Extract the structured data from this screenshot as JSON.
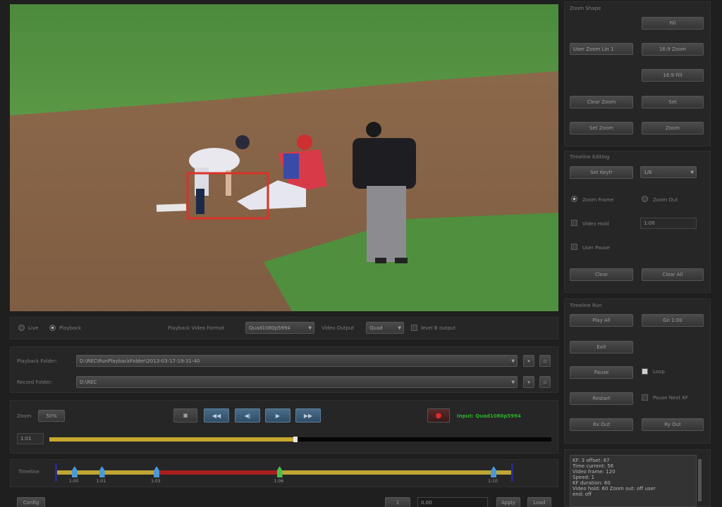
{
  "video": {
    "colors": {
      "grass": "#4f8a3e",
      "dirt": "#8a6a4a",
      "zoom_box": "#d8332a"
    }
  },
  "source": {
    "live_label": "Live",
    "playback_label": "Playback",
    "selected": "playback",
    "format_label": "Playback Video Format",
    "format_value": "Quad1080p5994",
    "output_label": "Video Output",
    "output_value": "Quad",
    "level_b_label": "level B output"
  },
  "folders": {
    "playback_label": "Playback Folder:",
    "playback_path": "D:\\REC\\RunPlaybackFolder\\2013-03-17-19-31-40",
    "record_label": "Record Folder:",
    "record_path": "D:\\REC"
  },
  "transport": {
    "zoom_label": "Zoom",
    "zoom_value": "50%",
    "input_status": "Input: Quad1080p5994",
    "timecode": "1:01",
    "progress": 0.49
  },
  "timeline": {
    "label": "Timeline",
    "keyframes": [
      {
        "label": "1:00",
        "pos": 0.04,
        "color": "#4a9ad8"
      },
      {
        "label": "1:01",
        "pos": 0.1,
        "color": "#4a9ad8"
      },
      {
        "label": "1:03",
        "pos": 0.22,
        "color": "#4a9ad8"
      },
      {
        "label": "1:06",
        "pos": 0.49,
        "color": "#4ac04a"
      },
      {
        "label": "1:10",
        "pos": 0.96,
        "color": "#4a9ad8"
      }
    ]
  },
  "zoom_shape": {
    "title": "Zoom Shape",
    "dropdown": "User Zoom Lin 1",
    "buttons": [
      "Fill",
      "16:9 Zoom",
      "16:9 Fill"
    ],
    "row_buttons": [
      "Clear Zoom",
      "Set",
      "Set Zoom",
      "Zoom"
    ]
  },
  "timeline_editing": {
    "title": "Timeline Editing",
    "set_button": "Set Keyfr",
    "dropdown": "1/8",
    "zoom_frame": "Zoom Frame",
    "zoom_out": "Zoom Out",
    "video_hold": "Video Hold",
    "hold_value": "1:00",
    "user_pause": "User Pause",
    "clear_button": "Clear",
    "clear_all_button": "Clear All"
  },
  "timeline_run": {
    "title": "Timeline Run",
    "buttons": [
      "Play All",
      "Go 1:00",
      "Exit",
      "Pause",
      "Restart",
      "Rx Out",
      "Ry Out"
    ],
    "loop_label": "Loop",
    "pause_label": "Pause Next KF"
  },
  "log": {
    "lines": [
      "KF: 3 offset: 67",
      "Time current: 56",
      "Video frame: 120",
      "Speed: 1",
      "KF duration: 60",
      "Video hold: 60 Zoom out: off user",
      "end: off"
    ]
  },
  "bottom": {
    "left_button": "Config",
    "page": "1",
    "field": "0.00",
    "btn1": "Apply",
    "btn2": "Load"
  }
}
